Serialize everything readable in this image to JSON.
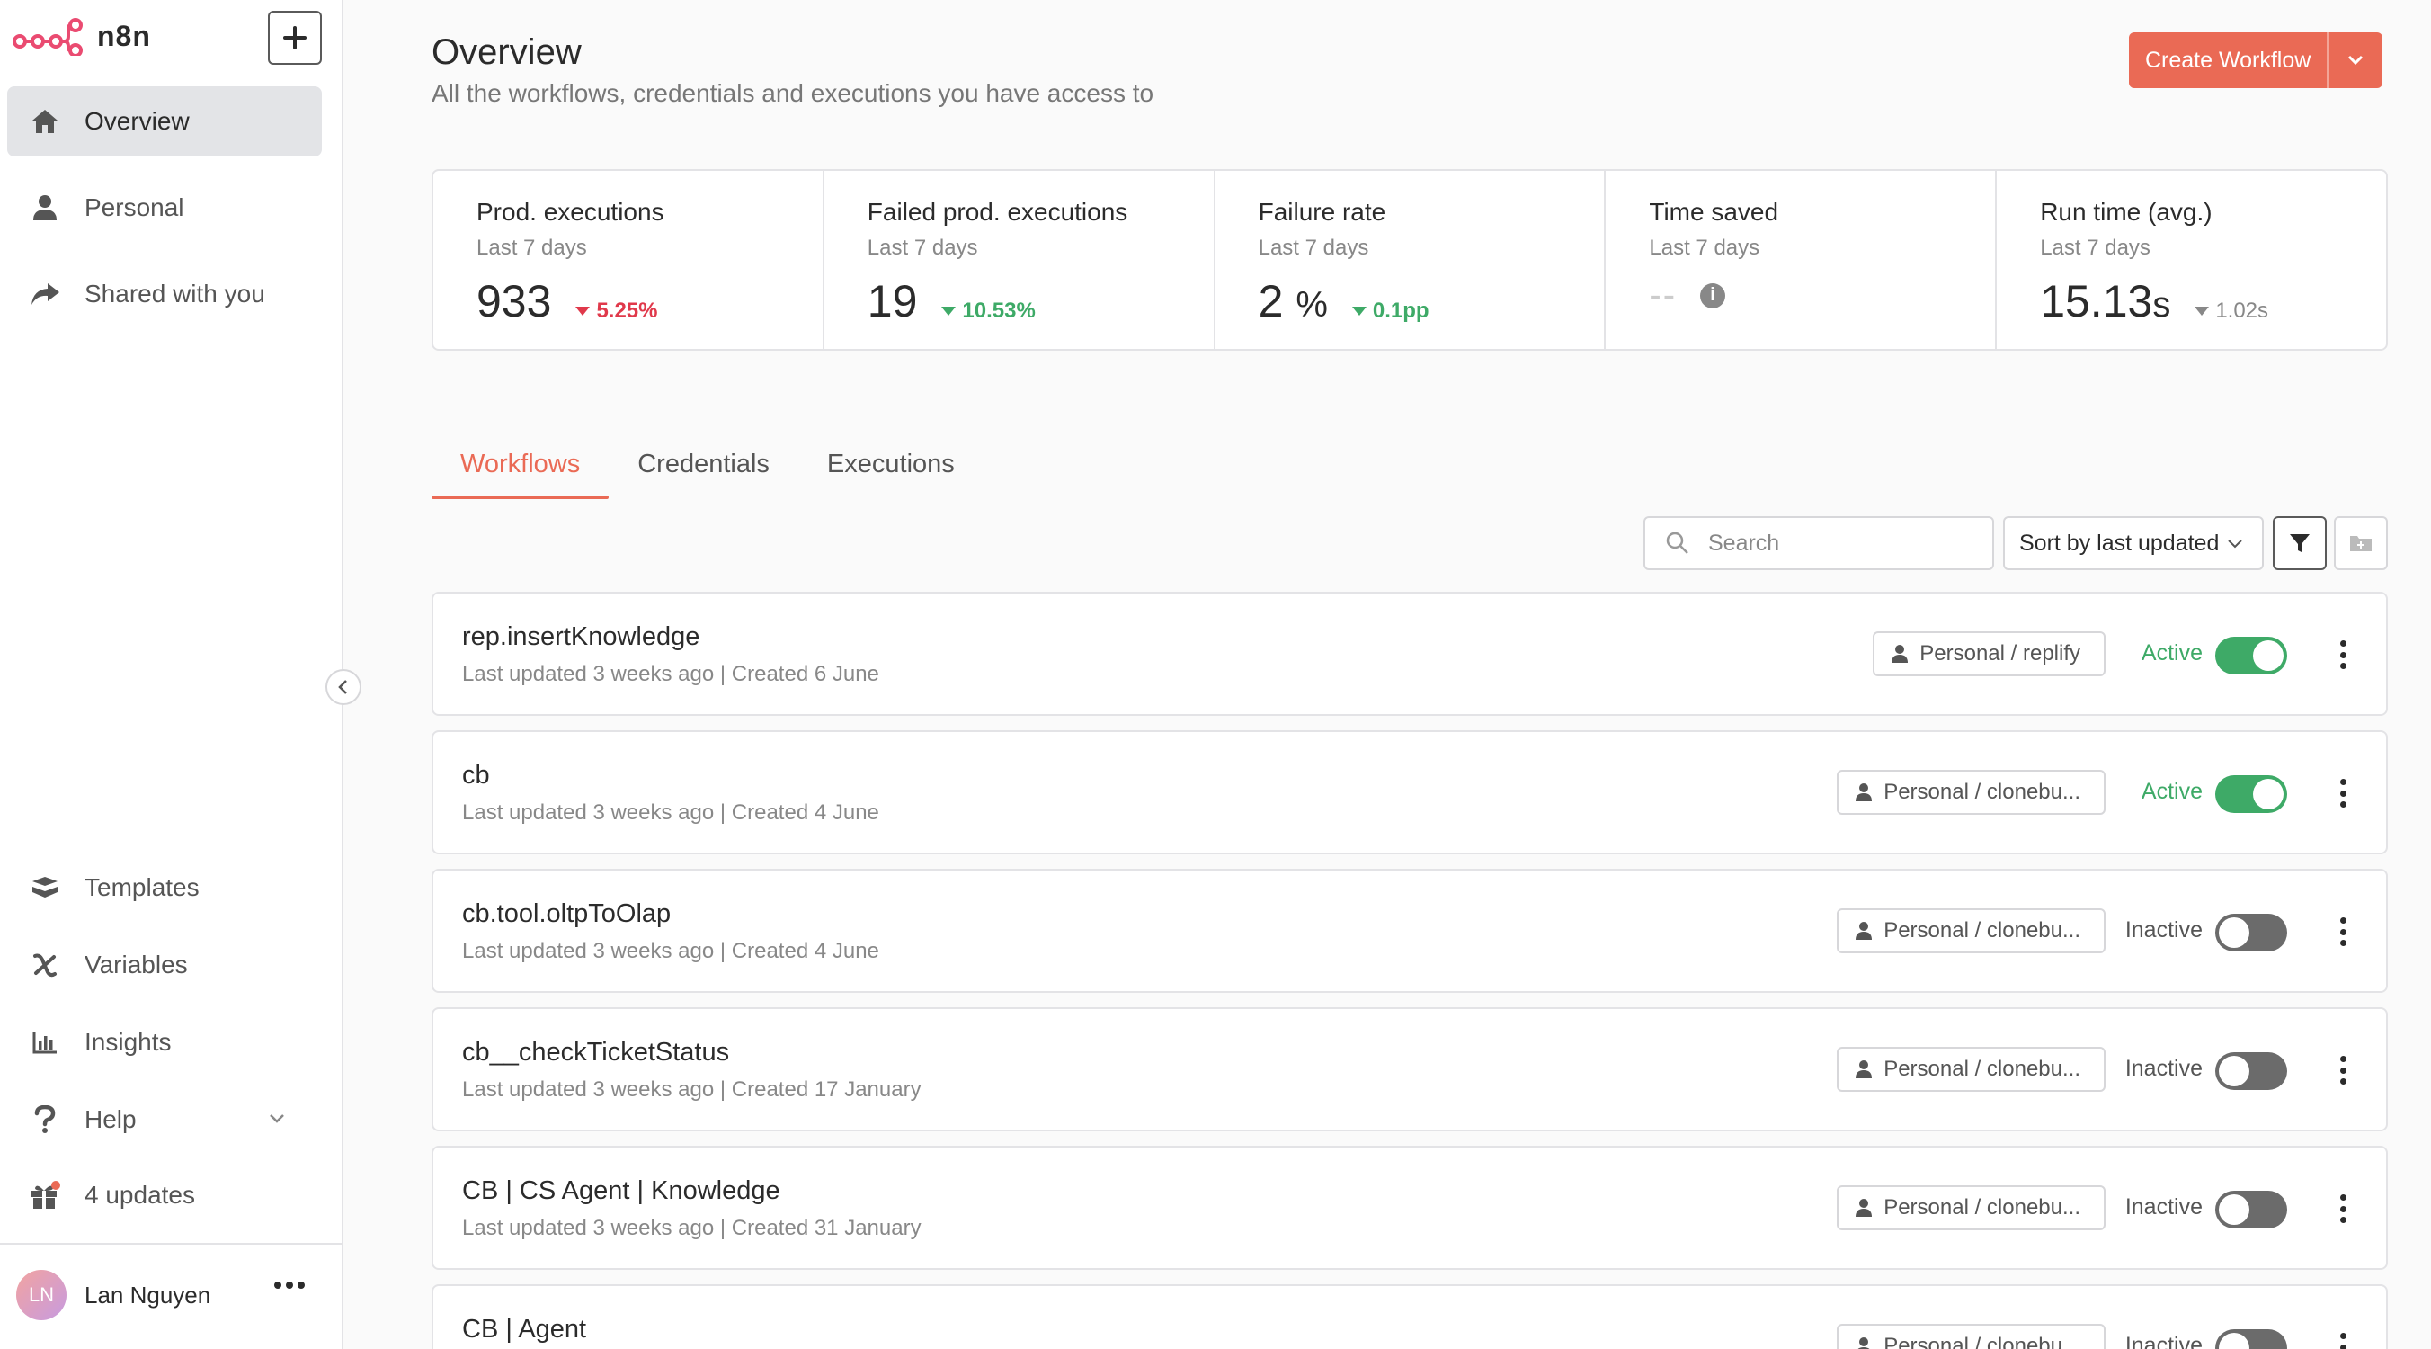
{
  "sidebar": {
    "logo_text": "n8n",
    "nav": [
      {
        "label": "Overview",
        "icon": "home-icon",
        "active": true
      },
      {
        "label": "Personal",
        "icon": "user-icon",
        "active": false
      },
      {
        "label": "Shared with you",
        "icon": "share-icon",
        "active": false
      }
    ],
    "bottom": [
      {
        "label": "Templates",
        "icon": "templates-icon"
      },
      {
        "label": "Variables",
        "icon": "variables-icon"
      },
      {
        "label": "Insights",
        "icon": "insights-icon"
      },
      {
        "label": "Help",
        "icon": "help-icon"
      },
      {
        "label": "4 updates",
        "icon": "gift-icon"
      }
    ],
    "user": {
      "initials": "LN",
      "name": "Lan Nguyen"
    }
  },
  "header": {
    "title": "Overview",
    "subtitle": "All the workflows, credentials and executions you have access to",
    "create_label": "Create Workflow"
  },
  "stats": [
    {
      "title": "Prod. executions",
      "period": "Last 7 days",
      "value": "933",
      "unit": "",
      "delta": "5.25%",
      "delta_color": "#e0394b"
    },
    {
      "title": "Failed prod. executions",
      "period": "Last 7 days",
      "value": "19",
      "unit": "",
      "delta": "10.53%",
      "delta_color": "#3eaa67"
    },
    {
      "title": "Failure rate",
      "period": "Last 7 days",
      "value": "2",
      "unit": "%",
      "delta": "0.1pp",
      "delta_color": "#3eaa67"
    },
    {
      "title": "Time saved",
      "period": "Last 7 days",
      "value": "--",
      "unit": "",
      "delta": "",
      "delta_color": ""
    },
    {
      "title": "Run time (avg.)",
      "period": "Last 7 days",
      "value": "15.13",
      "unit": "s",
      "delta": "1.02s",
      "delta_color": "#888888"
    }
  ],
  "tabs": [
    {
      "label": "Workflows",
      "active": true
    },
    {
      "label": "Credentials",
      "active": false
    },
    {
      "label": "Executions",
      "active": false
    }
  ],
  "toolbar": {
    "search_placeholder": "Search",
    "sort_label": "Sort by last updated"
  },
  "workflows": [
    {
      "name": "rep.insertKnowledge",
      "meta": "Last updated 3 weeks ago | Created 6 June",
      "owner": "Personal / replify",
      "status": "Active",
      "active": true
    },
    {
      "name": "cb",
      "meta": "Last updated 3 weeks ago | Created 4 June",
      "owner": "Personal / clonebu...",
      "status": "Active",
      "active": true
    },
    {
      "name": "cb.tool.oltpToOlap",
      "meta": "Last updated 3 weeks ago | Created 4 June",
      "owner": "Personal / clonebu...",
      "status": "Inactive",
      "active": false
    },
    {
      "name": "cb__checkTicketStatus",
      "meta": "Last updated 3 weeks ago | Created 17 January",
      "owner": "Personal / clonebu...",
      "status": "Inactive",
      "active": false
    },
    {
      "name": "CB | CS Agent | Knowledge",
      "meta": "Last updated 3 weeks ago | Created 31 January",
      "owner": "Personal / clonebu...",
      "status": "Inactive",
      "active": false
    },
    {
      "name": "CB | Agent",
      "meta": "",
      "owner": "Personal / clonebu...",
      "status": "Inactive",
      "active": false
    }
  ]
}
